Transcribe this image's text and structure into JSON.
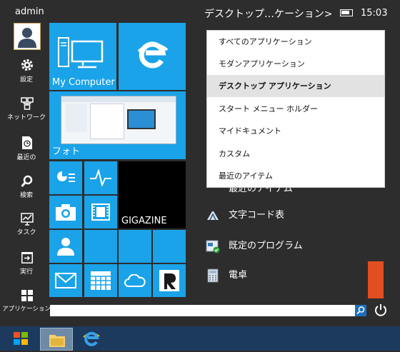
{
  "user": {
    "name": "admin"
  },
  "header": {
    "category": "デスクトップ…ケーション>",
    "time": "15:03"
  },
  "sidebar": {
    "items": [
      {
        "label": "設定",
        "icon": "gear-icon"
      },
      {
        "label": "ネットワーク",
        "icon": "network-icon"
      },
      {
        "label": "最近の",
        "icon": "recent-icon"
      },
      {
        "label": "検索",
        "icon": "search-icon"
      },
      {
        "label": "タスク",
        "icon": "task-icon"
      },
      {
        "label": "実行",
        "icon": "run-icon"
      },
      {
        "label": "アプリケーション",
        "icon": "apps-icon"
      }
    ]
  },
  "tiles": {
    "my_computer": "My Computer",
    "photo": "フォト",
    "gigazine": "GIGAZINE"
  },
  "dropdown": {
    "items": [
      "すべてのアプリケーション",
      "モダンアプリケーション",
      "デスクトップ アプリケーション",
      "スタート メニュー ホルダー",
      "マイドキュメント",
      "カスタム",
      "最近のアイテム"
    ],
    "selected_index": 2
  },
  "apps": {
    "partial": "最近のアイテム",
    "items": [
      "文字コード表",
      "既定のプログラム",
      "電卓"
    ]
  },
  "search": {
    "value": ""
  },
  "colors": {
    "accent": "#1aa3e8",
    "orange": "#e14e1f",
    "dark": "#2d2d2d"
  }
}
